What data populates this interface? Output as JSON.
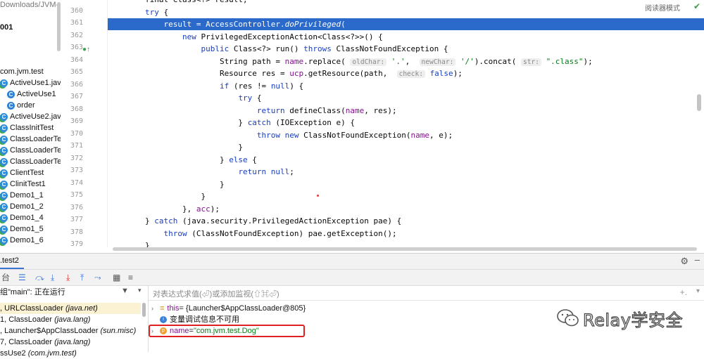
{
  "project_tree": {
    "path_text": "Downloads/JVM-",
    "bold_text": "001",
    "items": [
      {
        "text": "com.jvm.test",
        "icon": "none",
        "indent": 0
      },
      {
        "text": "ActiveUse1.jav",
        "icon": "class-ok",
        "indent": 1
      },
      {
        "text": "ActiveUse1",
        "icon": "class",
        "indent": 2
      },
      {
        "text": "order",
        "icon": "class",
        "indent": 2
      },
      {
        "text": "ActiveUse2.jav",
        "icon": "class-ok",
        "indent": 1
      },
      {
        "text": "ClassInitTest",
        "icon": "class-ok",
        "indent": 1
      },
      {
        "text": "ClassLoaderTe",
        "icon": "class-ok",
        "indent": 1
      },
      {
        "text": "ClassLoaderTe",
        "icon": "class-ok",
        "indent": 1
      },
      {
        "text": "ClassLoaderTe",
        "icon": "class-ok",
        "indent": 1
      },
      {
        "text": "ClientTest",
        "icon": "class-ok",
        "indent": 1
      },
      {
        "text": "ClinitTest1",
        "icon": "class-ok",
        "indent": 1
      },
      {
        "text": "Demo1_1",
        "icon": "class-ok",
        "indent": 1
      },
      {
        "text": "Demo1_2",
        "icon": "class-ok",
        "indent": 1
      },
      {
        "text": "Demo1_4",
        "icon": "class-ok",
        "indent": 1
      },
      {
        "text": "Demo1_5",
        "icon": "class-ok",
        "indent": 1
      },
      {
        "text": "Demo1_6",
        "icon": "class-ok",
        "indent": 1
      }
    ]
  },
  "editor": {
    "reader_mode_label": "阅读器模式",
    "line_numbers": [
      "359",
      "360",
      "361",
      "362",
      "363",
      "364",
      "365",
      "366",
      "367",
      "368",
      "369",
      "370",
      "371",
      "372",
      "373",
      "374",
      "375",
      "376",
      "377",
      "378",
      "379"
    ],
    "highlighted_line": "361"
  },
  "debug": {
    "tab_label": ".test2",
    "thread_selector": "组\"main\": 正在运行",
    "frames": [
      {
        "prefix": ", ",
        "method": "URLClassLoader",
        "pkg": "(java.net)",
        "selected": true
      },
      {
        "prefix": "1, ",
        "method": "ClassLoader",
        "pkg": "(java.lang)",
        "selected": false
      },
      {
        "prefix": ", ",
        "method": "Launcher$AppClassLoader",
        "pkg": "(sun.misc)",
        "selected": false
      },
      {
        "prefix": "7, ",
        "method": "ClassLoader",
        "pkg": "(java.lang)",
        "selected": false
      },
      {
        "prefix": "",
        "method": "ssUse2",
        "pkg": "(com.jvm.test)",
        "selected": false
      }
    ],
    "watch_placeholder": "对表达式求值(⏎)或添加监视(⇧⌘⏎)",
    "variables": {
      "this_name": "this",
      "this_value": " = {Launcher$AppClassLoader@805}",
      "info_text": "变量调试信息不可用",
      "name_name": "name",
      "name_eq": " = ",
      "name_value": "\"com.jvm.test.Dog\""
    }
  },
  "watermark": {
    "text": "Relay学安全"
  }
}
